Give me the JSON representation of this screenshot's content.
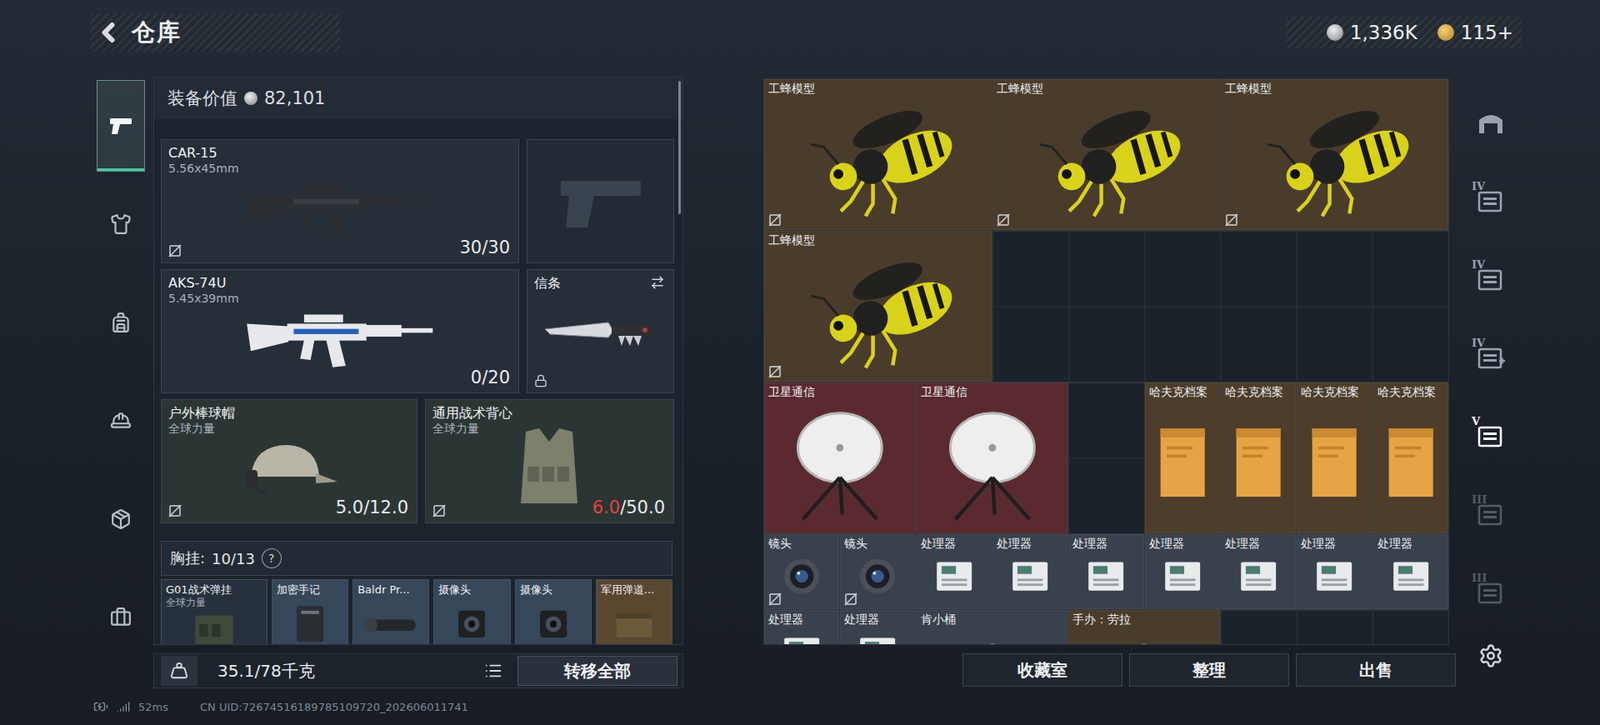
{
  "header": {
    "title": "仓库",
    "currencies": [
      {
        "kind": "silver",
        "value": "1,336K"
      },
      {
        "kind": "gold",
        "value": "115+"
      }
    ]
  },
  "side_tabs": [
    {
      "selected": true
    },
    {
      "selected": false
    },
    {
      "selected": false
    },
    {
      "selected": false
    },
    {
      "selected": false
    },
    {
      "selected": false
    }
  ],
  "loadout": {
    "value_label": "装备价值",
    "value": "82,101",
    "primary": {
      "name": "CAR-15",
      "caliber": "5.56x45mm",
      "ammo": "30/30",
      "bound": true
    },
    "sidearm": {
      "empty": true
    },
    "secondary": {
      "name": "AKS-74U",
      "caliber": "5.45x39mm",
      "ammo": "0/20",
      "bound": false
    },
    "melee": {
      "name": "信条",
      "locked": true
    },
    "helmet": {
      "name": "户外棒球帽",
      "brand": "全球力量",
      "durability": "5.0",
      "max": "/12.0",
      "low": false,
      "bound": true
    },
    "armor": {
      "name": "通用战术背心",
      "brand": "全球力量",
      "durability": "6.0",
      "max": "/50.0",
      "low": true,
      "bound": true
    },
    "rig": {
      "label": "胸挂:",
      "value": "10/13",
      "help": "?",
      "items": [
        {
          "name": "G01战术弹挂",
          "sub": "全球力量",
          "kind": "rig",
          "color": "#27313d"
        },
        {
          "name": "加密手记",
          "kind": "notebook",
          "color": "#36475a"
        },
        {
          "name": "Baldr Pr...",
          "kind": "scope",
          "color": "#36475a"
        },
        {
          "name": "摄像头",
          "kind": "camera",
          "color": "#36475a"
        },
        {
          "name": "摄像头",
          "kind": "camera",
          "color": "#36475a"
        },
        {
          "name": "军用弹道...",
          "kind": "ammo",
          "color": "#5b4630"
        }
      ]
    }
  },
  "weight": {
    "value": "35.1/78千克"
  },
  "transfer_button": "转移全部",
  "stash": {
    "items": [
      {
        "name": "工蜂模型",
        "kind": "bee",
        "cols": 3,
        "rows": 2,
        "color": "#4a3c2b",
        "bound": true
      },
      {
        "name": "工蜂模型",
        "kind": "bee",
        "cols": 3,
        "rows": 2,
        "color": "#4a3c2b",
        "bound": true
      },
      {
        "name": "工蜂模型",
        "kind": "bee",
        "cols": 3,
        "rows": 2,
        "color": "#4a3c2b",
        "bound": true
      },
      {
        "name": "工蜂模型",
        "kind": "bee",
        "cols": 3,
        "rows": 2,
        "color": "#4a3c2b",
        "bound": true
      },
      {
        "kind": "empty",
        "cols": 6,
        "rows": 2
      },
      {
        "name": "卫星通信",
        "kind": "dish",
        "cols": 2,
        "rows": 2,
        "color": "#5a2a30",
        "bound": false
      },
      {
        "name": "卫星通信",
        "kind": "dish",
        "cols": 2,
        "rows": 2,
        "color": "#5a2a30",
        "bound": false
      },
      {
        "kind": "empty",
        "cols": 1,
        "rows": 2
      },
      {
        "name": "哈夫克档案",
        "kind": "folder",
        "cols": 1,
        "rows": 2,
        "color": "#4d3d2a",
        "bound": false
      },
      {
        "name": "哈夫克档案",
        "kind": "folder",
        "cols": 1,
        "rows": 2,
        "color": "#4d3d2a",
        "bound": false
      },
      {
        "name": "哈夫克档案",
        "kind": "folder",
        "cols": 1,
        "rows": 2,
        "color": "#4d3d2a",
        "bound": false
      },
      {
        "name": "哈夫克档案",
        "kind": "folder",
        "cols": 1,
        "rows": 2,
        "color": "#4d3d2a",
        "bound": false
      },
      {
        "name": "镜头",
        "kind": "lens",
        "cols": 1,
        "rows": 1,
        "color": "#39414c",
        "bound": true
      },
      {
        "name": "镜头",
        "kind": "lens",
        "cols": 1,
        "rows": 1,
        "color": "#39414c",
        "bound": true
      },
      {
        "name": "处理器",
        "kind": "processor",
        "cols": 1,
        "rows": 1,
        "color": "#39414c",
        "bound": false
      },
      {
        "name": "处理器",
        "kind": "processor",
        "cols": 1,
        "rows": 1,
        "color": "#39414c",
        "bound": false
      },
      {
        "name": "处理器",
        "kind": "processor",
        "cols": 1,
        "rows": 1,
        "color": "#39414c",
        "bound": false
      },
      {
        "name": "处理器",
        "kind": "processor",
        "cols": 1,
        "rows": 1,
        "color": "#39414c",
        "bound": false
      },
      {
        "name": "处理器",
        "kind": "processor",
        "cols": 1,
        "rows": 1,
        "color": "#39414c",
        "bound": false
      },
      {
        "name": "处理器",
        "kind": "processor",
        "cols": 1,
        "rows": 1,
        "color": "#39414c",
        "bound": false
      },
      {
        "name": "处理器",
        "kind": "processor",
        "cols": 1,
        "rows": 1,
        "color": "#39414c",
        "bound": false
      },
      {
        "name": "处理器",
        "kind": "processor",
        "cols": 1,
        "rows": 1,
        "color": "#39414c",
        "bound": false
      },
      {
        "name": "处理器",
        "kind": "processor",
        "cols": 1,
        "rows": 1,
        "color": "#39414c",
        "bound": false
      },
      {
        "name": "肯小桶",
        "kind": "figure",
        "cols": 2,
        "rows": 2,
        "color": "#39414c",
        "bound": false
      },
      {
        "name": "手办：劳拉",
        "kind": "figure",
        "cols": 2,
        "rows": 2,
        "color": "#4a3c2b",
        "bound": false
      },
      {
        "kind": "empty",
        "cols": 3,
        "rows": 2
      }
    ]
  },
  "stash_tabs": [
    {
      "kind": "home",
      "selected": false,
      "disabled": false
    },
    {
      "kind": "case",
      "label": "IV",
      "selected": false,
      "disabled": false
    },
    {
      "kind": "case",
      "label": "IV",
      "selected": false,
      "disabled": false
    },
    {
      "kind": "case-plus",
      "label": "IV",
      "selected": false,
      "disabled": false
    },
    {
      "kind": "case",
      "label": "V",
      "selected": true,
      "disabled": false
    },
    {
      "kind": "case",
      "label": "III",
      "selected": false,
      "disabled": true
    },
    {
      "kind": "case",
      "label": "III",
      "selected": false,
      "disabled": true
    }
  ],
  "actions": [
    "收藏室",
    "整理",
    "出售"
  ],
  "status_bar": {
    "ping": "52ms",
    "uid": "CN UID:72674516189785109720_202606011741"
  }
}
